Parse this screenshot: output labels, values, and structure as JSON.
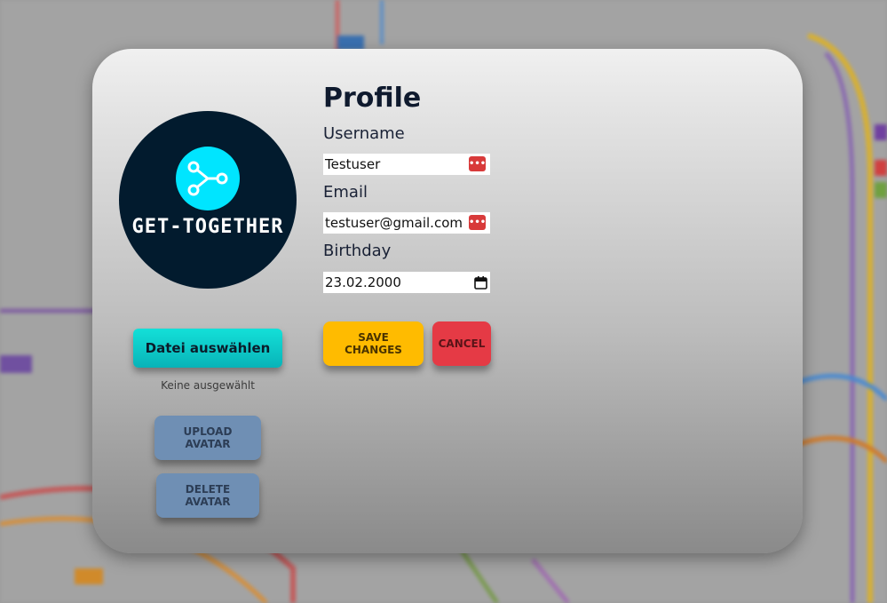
{
  "profile": {
    "title": "Profile",
    "avatar_text": "GET-TOGETHER",
    "file_button_label": "Datei auswählen",
    "file_status": "Keine ausgewählt",
    "upload_avatar_label": "UPLOAD AVATAR",
    "delete_avatar_label": "DELETE AVATAR",
    "username_label": "Username",
    "username_value": "Testuser",
    "email_label": "Email",
    "email_value": "testuser@gmail.com",
    "birthday_label": "Birthday",
    "birthday_value": "23.02.2000",
    "password_manager_icon_glyph": "•••",
    "save_label": "SAVE CHANGES",
    "cancel_label": "CANCEL"
  },
  "colors": {
    "file_button": "#0fd2d0",
    "avatar_buttons": "#6f8fb4",
    "save_button": "#ffbb00",
    "cancel_button": "#e53a45",
    "avatar_background": "#021b2e",
    "logo_accent": "#00e5ff"
  },
  "icons": {
    "logo": "share-nodes-icon",
    "password_manager": "password-manager-icon",
    "calendar": "calendar-icon"
  }
}
